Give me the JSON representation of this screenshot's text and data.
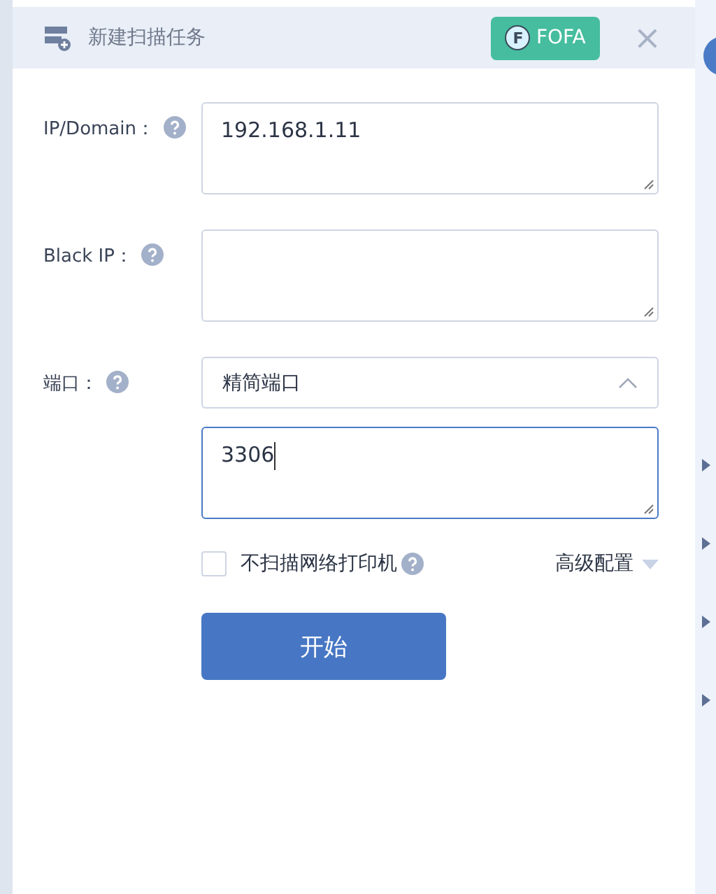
{
  "dialog": {
    "title": "新建扫描任务",
    "fofa_button": {
      "label": "FOFA",
      "icon_text": "F"
    },
    "close": "×"
  },
  "fields": [
    {
      "kind": "textarea",
      "label": "IP/Domain：",
      "value": "192.168.1.11",
      "focused": false
    },
    {
      "kind": "textarea",
      "label": "Black IP：",
      "focused": false
    },
    {
      "kind": "select",
      "label": "端口：",
      "value": "精简端口",
      "expanded": true
    },
    {
      "kind": "textarea",
      "value": "3306",
      "focused": true
    }
  ],
  "printer_option": {
    "label": "不扫描网络打印机",
    "checked": false
  },
  "advanced": {
    "label": "高级配置",
    "expanded": false
  },
  "start_button": "开始"
}
